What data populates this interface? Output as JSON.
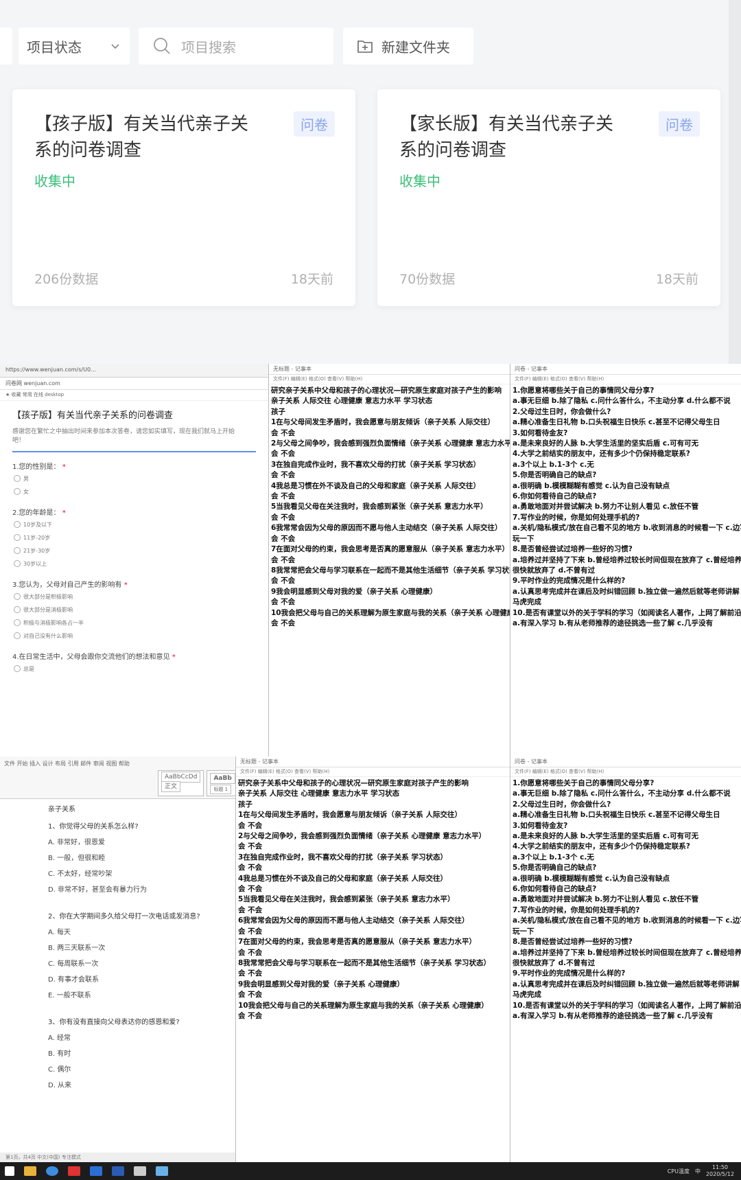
{
  "filters": {
    "status_label": "项目状态",
    "search_placeholder": "项目搜索",
    "new_folder_label": "新建文件夹"
  },
  "cards": [
    {
      "title": "【孩子版】有关当代亲子关系的问卷调查",
      "tag": "问卷",
      "status": "收集中",
      "count": "206份数据",
      "ago": "18天前"
    },
    {
      "title": "【家长版】有关当代亲子关系的问卷调查",
      "tag": "问卷",
      "status": "收集中",
      "count": "70份数据",
      "ago": "18天前"
    }
  ],
  "colors": {
    "status_green": "#3bbf7a",
    "tag_blue": "#8aa4e8",
    "accent": "#5b8ff0"
  },
  "browser": {
    "url": "https://www.wenjuan.com/s/U0...",
    "tab": "问卷网 wenjuan.com",
    "favs": "★ 收藏   常用   在线   desktop",
    "title": "【孩子版】有关当代亲子关系的问卷调查",
    "desc": "感谢您在繁忙之中抽出时间来参加本次答卷，请您如实填写，现在我们就马上开始吧！",
    "questions": [
      {
        "q": "1.您的性别是：",
        "opts": [
          "男",
          "女"
        ]
      },
      {
        "q": "2.您的年龄是：",
        "opts": [
          "10岁及以下",
          "11岁-20岁",
          "21岁-30岁",
          "30岁以上"
        ]
      },
      {
        "q": "3.您认为，父母对自己产生的影响有",
        "opts": [
          "很大部分是积极影响",
          "很大部分是消极影响",
          "积极与消极影响各占一半",
          "对自己没有什么影响"
        ]
      },
      {
        "q": "4.在日常生活中，父母会跟你交流他们的想法和意见",
        "opts": [
          "总是"
        ]
      }
    ]
  },
  "notepad_top_mid": {
    "title": "无标题 - 记事本",
    "menu": "文件(F)  编辑(E)  格式(O)  查看(V)  帮助(H)",
    "lines": [
      "研究亲子关系中父母和孩子的心理状况—研究原生家庭对孩子产生的影响",
      "亲子关系 人际交往 心理健康 意志力水平 学习状态",
      "孩子",
      "1在与父母间发生矛盾时，我会愿意与朋友倾诉（亲子关系 人际交往）",
      "会 不会",
      "2与父母之间争吵，我会感到强烈负面情绪（亲子关系 心理健康 意志力水平）",
      "会 不会",
      "3在独自完成作业时，我不喜欢父母的打扰（亲子关系 学习状态）",
      "会 不会",
      "4我总是习惯在外不谈及自己的父母和家庭（亲子关系 人际交往）",
      "会 不会",
      "5当我看见父母在关注我时，我会感到紧张（亲子关系 意志力水平）",
      "会 不会",
      "6我常常会因为父母的原因而不愿与他人主动结交（亲子关系 人际交往）",
      "会 不会",
      "7在面对父母的约束，我会思考是否真的愿意服从（亲子关系 意志力水平）",
      "会 不会",
      "8我常常把会父母与学习联系在一起而不是其他生活细节（亲子关系 学习状态）",
      "会 不会",
      "9我会明显感到父母对我的爱（亲子关系 心理健康）",
      "会 不会",
      "10我会把父母与自己的关系理解为原生家庭与我的关系（亲子关系 心理健康）",
      "会 不会"
    ]
  },
  "notepad_top_right": {
    "title": "问卷 - 记事本",
    "menu": "文件(F)  编辑(E)  格式(O)  查看(V)  帮助(H)",
    "lines": [
      "1.你愿意将哪些关于自己的事情同父母分享?",
      "a.事无巨细  b.除了隐私  c.问什么答什么，不主动分享  d.什么都不说",
      "2.父母过生日时，你会做什么?",
      "a.精心准备生日礼物  b.口头祝福生日快乐  c.甚至不记得父母生日",
      "3.如何看待金友?",
      "a.是未来良好的人脉  b.大学生活里的坚实后盾  c.可有可无",
      "4.大学之前结实的朋友中，还有多少个仍保持稳定联系?",
      "a.3个以上  b.1-3个  c.无",
      "5.你是否明确自己的缺点?",
      "a.很明确  b.模模糊糊有感觉  c.认为自己没有缺点",
      "6.你如何看待自己的缺点?",
      "a.勇敢地面对并尝试解决  b.努力不让别人看见  c.放任不管",
      "7.写作业的时候，你是如何处理手机的?",
      "a.关机/隐私模式/放在自己看不见的地方  b.收到消息的时候看一下  c.边写边玩一下",
      "玩一下",
      "8.是否曾经尝试过培养一些好的习惯?",
      "a.培养过并坚持了下来  b.曾经培养过较长时间但现在放弃了  c.曾经培养过但",
      "很快就放弃了  d.不曾有过",
      "9.平时作业的完成情况是什么样的?",
      "a.认真思考完成并在课后及时纠错回顾  b.独立做一遍然后就等老师讲解  c.",
      "马虎完成",
      "10.是否有课堂以外的关于学科的学习（如阅读名人著作，上网了解前沿知识）",
      "a.有深入学习  b.有从老师推荐的途径挑选一些了解  c.几乎没有"
    ]
  },
  "word": {
    "tab": "亲子关系",
    "ribbon_row1": "文件  开始  插入  设计  布局  引用  邮件  审阅  视图  帮助",
    "style_normal": "AaBbCcDd",
    "style_heading": "AaBb",
    "style_normal_label": "正文",
    "style_heading_label": "标题 1",
    "heading": "亲子关系",
    "items": [
      {
        "q": "1、你觉得父母的关系怎么样?",
        "opts": [
          "A. 非常好，很恩爱",
          "B. 一般，但很和睦",
          "C. 不太好，经常吵架",
          "D. 非常不好，甚至会有暴力行为"
        ]
      },
      {
        "q": "2、你在大学期间多久给父母打一次电话或发消息?",
        "opts": [
          "A. 每天",
          "B. 两三天联系一次",
          "C. 每周联系一次",
          "D. 有事才会联系",
          "E. 一般不联系"
        ]
      },
      {
        "q": "3、你有没有直接向父母表达你的感恩和爱?",
        "opts": [
          "A. 经常",
          "B. 有时",
          "C. 偶尔",
          "D. 从来"
        ]
      }
    ],
    "status": "第1页，共4页    中文(中国)    专注模式"
  },
  "taskbar": {
    "time": "11:50",
    "date": "2020/5/12",
    "lang": "中",
    "cpu": "CPU温度"
  }
}
